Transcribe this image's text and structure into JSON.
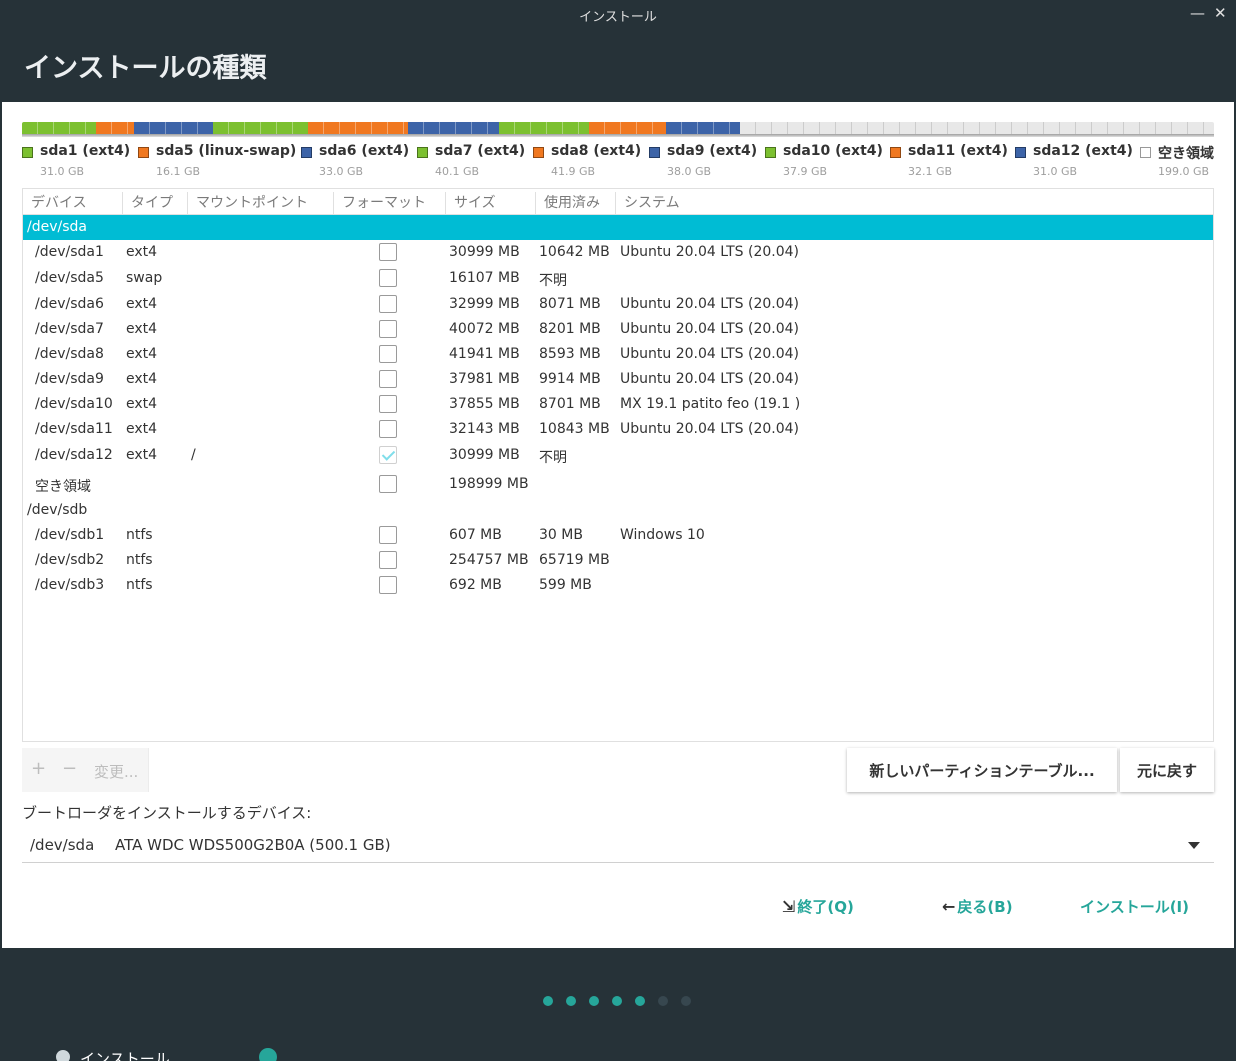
{
  "window": {
    "title": "インストール",
    "minimize_glyph": "—",
    "close_glyph": "✕"
  },
  "header": {
    "title": "インストールの種類"
  },
  "partition_bar": {
    "segments": [
      {
        "color": "#7cc030",
        "size_gb": 31.0
      },
      {
        "color": "#f07820",
        "size_gb": 16.1
      },
      {
        "color": "#3d64a8",
        "size_gb": 33.0
      },
      {
        "color": "#7cc030",
        "size_gb": 40.1
      },
      {
        "color": "#f07820",
        "size_gb": 41.9
      },
      {
        "color": "#3d64a8",
        "size_gb": 38.0
      },
      {
        "color": "#7cc030",
        "size_gb": 37.9
      },
      {
        "color": "#f07820",
        "size_gb": 32.1
      },
      {
        "color": "#3d64a8",
        "size_gb": 31.0
      },
      {
        "color": "#e8e8e8",
        "size_gb": 199.0,
        "free": true
      }
    ]
  },
  "legend": [
    {
      "name": "sda1 (ext4)",
      "size": "31.0 GB",
      "color": "#7cc030"
    },
    {
      "name": "sda5 (linux-swap)",
      "size": "16.1 GB",
      "color": "#f07820"
    },
    {
      "name": "sda6 (ext4)",
      "size": "33.0 GB",
      "color": "#3d64a8"
    },
    {
      "name": "sda7 (ext4)",
      "size": "40.1 GB",
      "color": "#7cc030"
    },
    {
      "name": "sda8 (ext4)",
      "size": "41.9 GB",
      "color": "#f07820"
    },
    {
      "name": "sda9 (ext4)",
      "size": "38.0 GB",
      "color": "#3d64a8"
    },
    {
      "name": "sda10 (ext4)",
      "size": "37.9 GB",
      "color": "#7cc030"
    },
    {
      "name": "sda11 (ext4)",
      "size": "32.1 GB",
      "color": "#f07820"
    },
    {
      "name": "sda12 (ext4)",
      "size": "31.0 GB",
      "color": "#3d64a8"
    },
    {
      "name": "空き領域",
      "size": "199.0 GB",
      "color": "#ffffff"
    }
  ],
  "table": {
    "headers": [
      "デバイス",
      "タイプ",
      "マウントポイント",
      "フォーマット",
      "サイズ",
      "使用済み",
      "システム"
    ],
    "rows": [
      {
        "device": "/dev/sda",
        "kind": "disk",
        "selected": true
      },
      {
        "device": "/dev/sda1",
        "type": "ext4",
        "mount": "",
        "format": false,
        "size": "30999 MB",
        "used": "10642 MB",
        "system": "Ubuntu 20.04 LTS (20.04)"
      },
      {
        "device": "/dev/sda5",
        "type": "swap",
        "mount": "",
        "format": false,
        "size": "16107 MB",
        "used": "不明",
        "system": ""
      },
      {
        "device": "/dev/sda6",
        "type": "ext4",
        "mount": "",
        "format": false,
        "size": "32999 MB",
        "used": "8071 MB",
        "system": "Ubuntu 20.04 LTS (20.04)"
      },
      {
        "device": "/dev/sda7",
        "type": "ext4",
        "mount": "",
        "format": false,
        "size": "40072 MB",
        "used": "8201 MB",
        "system": "Ubuntu 20.04 LTS (20.04)"
      },
      {
        "device": "/dev/sda8",
        "type": "ext4",
        "mount": "",
        "format": false,
        "size": "41941 MB",
        "used": "8593 MB",
        "system": "Ubuntu 20.04 LTS (20.04)"
      },
      {
        "device": "/dev/sda9",
        "type": "ext4",
        "mount": "",
        "format": false,
        "size": "37981 MB",
        "used": "9914 MB",
        "system": "Ubuntu 20.04 LTS (20.04)"
      },
      {
        "device": "/dev/sda10",
        "type": "ext4",
        "mount": "",
        "format": false,
        "size": "37855 MB",
        "used": "8701 MB",
        "system": "MX 19.1 patito feo (19.1 )"
      },
      {
        "device": "/dev/sda11",
        "type": "ext4",
        "mount": "",
        "format": false,
        "size": "32143 MB",
        "used": "10843 MB",
        "system": "Ubuntu 20.04 LTS (20.04)"
      },
      {
        "device": "/dev/sda12",
        "type": "ext4",
        "mount": "/",
        "format": true,
        "size": "30999 MB",
        "used": "不明",
        "system": ""
      },
      {
        "device": "空き領域",
        "type": "",
        "mount": "",
        "format": false,
        "size": "198999 MB",
        "used": "",
        "system": ""
      },
      {
        "device": "/dev/sdb",
        "kind": "disk",
        "selected": false
      },
      {
        "device": "/dev/sdb1",
        "type": "ntfs",
        "mount": "",
        "format": false,
        "size": "607 MB",
        "used": "30 MB",
        "system": "Windows 10"
      },
      {
        "device": "/dev/sdb2",
        "type": "ntfs",
        "mount": "",
        "format": false,
        "size": "254757 MB",
        "used": "65719 MB",
        "system": ""
      },
      {
        "device": "/dev/sdb3",
        "type": "ntfs",
        "mount": "",
        "format": false,
        "size": "692 MB",
        "used": "599 MB",
        "system": ""
      }
    ]
  },
  "tools": {
    "add": "+",
    "remove": "−",
    "change": "変更..."
  },
  "buttons": {
    "new_table": "新しいパーティションテーブル...",
    "revert": "元に戻す",
    "quit": "終了(Q)",
    "back": "戻る(B)",
    "install": "インストール(I)"
  },
  "bootloader": {
    "label": "ブートローダをインストールするデバイス:",
    "device": "/dev/sda",
    "model": "ATA WDC WDS500G2B0A (500.1 GB)"
  },
  "progress": {
    "total_steps": 7,
    "completed_steps": 5,
    "active_color": "#26a69a",
    "inactive_color": "#37474f"
  },
  "taskbar": {
    "label": "インストール"
  }
}
